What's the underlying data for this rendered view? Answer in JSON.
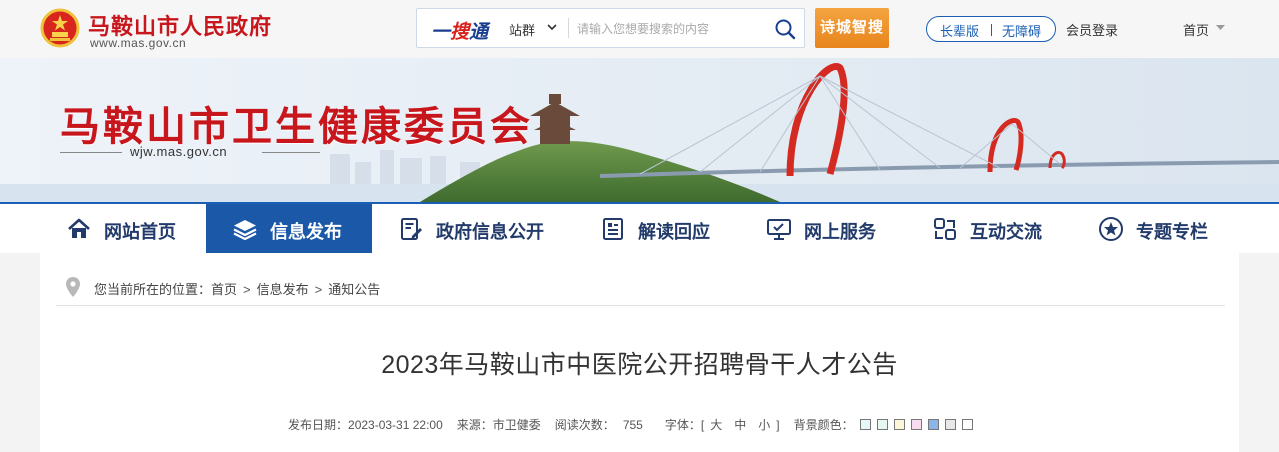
{
  "header": {
    "gov_name": "马鞍山市人民政府",
    "gov_url": "www.mas.gov.cn",
    "search": {
      "brand_prefix": "一",
      "brand_main": "搜",
      "brand_suffix": "通",
      "scope_label": "站群",
      "placeholder": "请输入您想要搜索的内容"
    },
    "feature_button": "诗城智搜",
    "elder_label": "长辈版",
    "accessible_label": "无障碍",
    "member_login": "会员登录",
    "home_label": "首页"
  },
  "banner": {
    "title": "马鞍山市卫生健康委员会",
    "url": "wjw.mas.gov.cn"
  },
  "nav": {
    "items": [
      {
        "label": "网站首页",
        "icon": "home-icon",
        "active": false
      },
      {
        "label": "信息发布",
        "icon": "layers-icon",
        "active": true
      },
      {
        "label": "政府信息公开",
        "icon": "document-edit-icon",
        "active": false
      },
      {
        "label": "解读回应",
        "icon": "report-icon",
        "active": false
      },
      {
        "label": "网上服务",
        "icon": "monitor-icon",
        "active": false
      },
      {
        "label": "互动交流",
        "icon": "interaction-icon",
        "active": false
      },
      {
        "label": "专题专栏",
        "icon": "star-icon",
        "active": false
      }
    ]
  },
  "breadcrumb": {
    "prefix": "您当前所在的位置：",
    "items": [
      "首页",
      "信息发布",
      "通知公告"
    ],
    "separator": ">"
  },
  "article": {
    "title": "2023年马鞍山市中医院公开招聘骨干人才公告",
    "publish_label": "发布日期：",
    "publish_date": "2023-03-31 22:00",
    "source_label": "来源：",
    "source": "市卫健委",
    "views_label": "阅读次数：",
    "views": "755",
    "font_label": "字体：",
    "font_open": "[",
    "font_large": "大",
    "font_medium": "中",
    "font_small": "小",
    "font_close": "]",
    "bg_label": "背景颜色：",
    "bg_colors": [
      "#e6f7f7",
      "#e6f8f0",
      "#fbf7d8",
      "#f7dcf2",
      "#8bb4e8",
      "#e8e8e8",
      "#ffffff"
    ]
  },
  "colors": {
    "brand_red": "#c8161d",
    "nav_blue": "#1b58a8",
    "nav_text": "#233b6b",
    "accent_orange": "#e8841c"
  }
}
